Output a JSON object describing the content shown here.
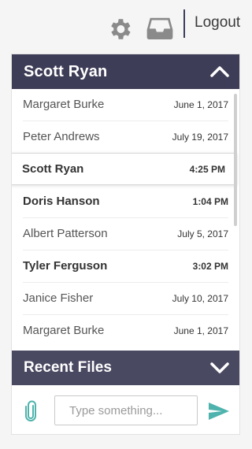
{
  "header": {
    "logout_label": "Logout"
  },
  "icons": {
    "settings": "gear-icon",
    "inbox": "inbox-icon",
    "attach": "paperclip-icon",
    "send": "send-icon",
    "collapse": "chevron-up-icon",
    "expand": "chevron-down-icon"
  },
  "chat_panel": {
    "title": "Scott Ryan",
    "conversations": [
      {
        "name": "Margaret Burke",
        "date": "June 1, 2017"
      },
      {
        "name": "Peter Andrews",
        "date": "July 19, 2017"
      },
      {
        "name": "Scott Ryan",
        "date": "4:25 PM"
      },
      {
        "name": "Doris Hanson",
        "date": "1:04 PM"
      },
      {
        "name": "Albert Patterson",
        "date": "July 5, 2017"
      },
      {
        "name": "Tyler Ferguson",
        "date": "3:02 PM"
      },
      {
        "name": "Janice Fisher",
        "date": "July 10, 2017"
      },
      {
        "name": "Margaret Burke",
        "date": "June 1, 2017"
      }
    ]
  },
  "files_panel": {
    "title": "Recent Files"
  },
  "composer": {
    "placeholder": "Type something..."
  },
  "colors": {
    "header_bg": "#3e3d57",
    "accent_teal": "#4fb3ad",
    "text_dark": "#333333"
  }
}
